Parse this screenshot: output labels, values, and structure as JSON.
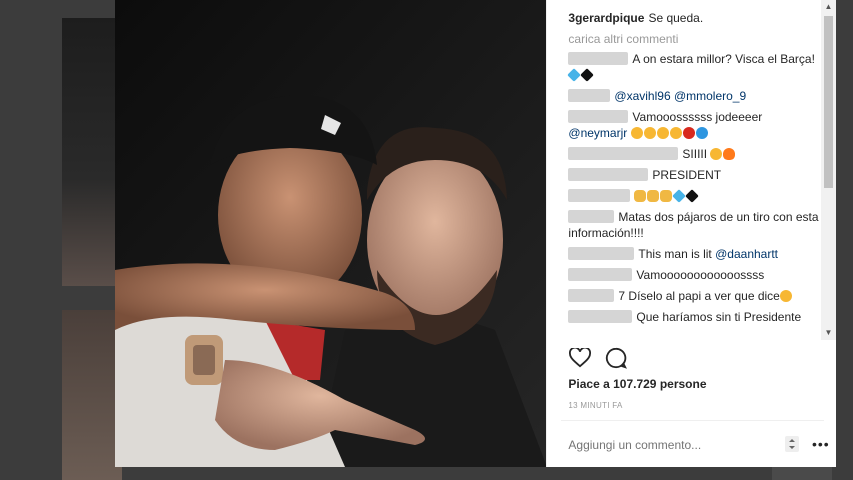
{
  "post": {
    "caption_user": "3gerardpique",
    "caption_text": "Se queda.",
    "load_more": "carica altri commenti",
    "comments": [
      {
        "text": "A on estara millor? Visca el Barça!"
      },
      {
        "mentions": "@xavihl96 @mmolero_9"
      },
      {
        "user_partial": "",
        "text": "Vamooossssss jodeeeer",
        "mention": "@neymarjr"
      },
      {
        "text": "SIIIII"
      },
      {
        "text": "PRESIDENT"
      },
      {
        "text": "Matas dos pájaros de un tiro con esta información!!!!"
      },
      {
        "text": "This man is lit",
        "mention": "@daanhartt"
      },
      {
        "text": "Vamoooooooooooossss"
      },
      {
        "text": "7 Díselo al papi a ver que dice"
      },
      {
        "text": "Que haríamos sin ti Presidente"
      }
    ],
    "likes": "Piace a 107.729 persone",
    "time": "13 MINUTI FA",
    "add_comment_placeholder": "Aggiungi un commento...",
    "more_icon": "•••"
  },
  "icons": {
    "like": "heart-icon",
    "comment": "comment-icon",
    "more": "ellipsis-icon"
  },
  "colors": {
    "mention": "#003569",
    "text": "#262626",
    "muted": "#999999"
  }
}
